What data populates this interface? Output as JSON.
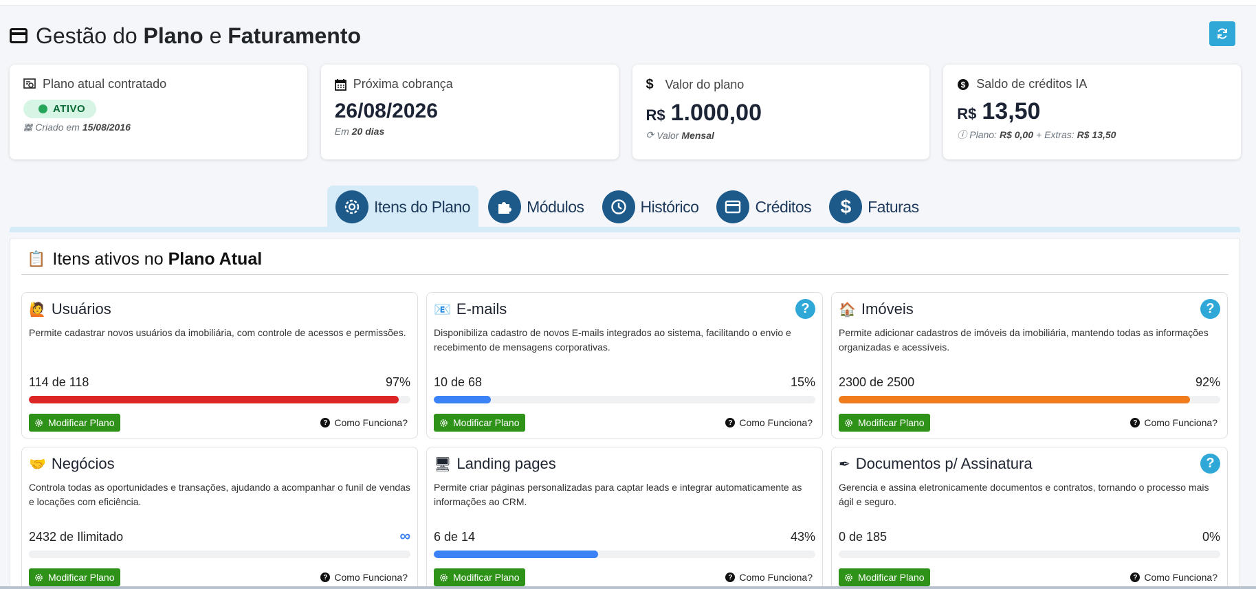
{
  "header": {
    "title_prefix": "Gestão do",
    "title_b1": "Plano",
    "title_mid": "e",
    "title_b2": "Faturamento"
  },
  "stats": {
    "plan": {
      "label": "Plano atual contratado",
      "status": "ATIVO",
      "created_prefix": "Criado em",
      "created_date": "15/08/2016"
    },
    "next": {
      "label": "Próxima cobrança",
      "date": "26/08/2026",
      "in_prefix": "Em",
      "in_days": "20 dias"
    },
    "value": {
      "label": "Valor do plano",
      "currency": "R$",
      "amount": "1.000,00",
      "period_prefix": "Valor",
      "period": "Mensal"
    },
    "credits": {
      "label": "Saldo de créditos IA",
      "currency": "R$",
      "amount": "13,50",
      "plan_prefix": "Plano:",
      "plan_val": "R$ 0,00",
      "extras_prefix": "+ Extras:",
      "extras_val": "R$ 13,50"
    }
  },
  "tabs": [
    {
      "label": "Itens do Plano",
      "icon": "gear-icon"
    },
    {
      "label": "Módulos",
      "icon": "puzzle-icon"
    },
    {
      "label": "Histórico",
      "icon": "history-icon"
    },
    {
      "label": "Créditos",
      "icon": "credit-card-icon"
    },
    {
      "label": "Faturas",
      "icon": "dollar-icon"
    }
  ],
  "panel": {
    "title_prefix": "Itens ativos no",
    "title_bold": "Plano Atual",
    "icon": "📋"
  },
  "cards": [
    {
      "icon": "🙋",
      "title": "Usuários",
      "help": false,
      "desc": "Permite cadastrar novos usuários da imobiliária, com controle de acessos e permissões.",
      "usage": "114 de 118",
      "pct": "97%",
      "fill": 0.97,
      "color": "#dc2626",
      "modify": "Modificar Plano",
      "how": "Como Funciona?"
    },
    {
      "icon": "📧",
      "title": "E-mails",
      "help": true,
      "desc": "Disponibiliza cadastro de novos E-mails integrados ao sistema, facilitando o envio e recebimento de mensagens corporativas.",
      "usage": "10 de 68",
      "pct": "15%",
      "fill": 0.15,
      "color": "#3b82f6",
      "modify": "Modificar Plano",
      "how": "Como Funciona?"
    },
    {
      "icon": "🏠",
      "title": "Imóveis",
      "help": true,
      "desc": "Permite adicionar cadastros de imóveis da imobiliária, mantendo todas as informações organizadas e acessíveis.",
      "usage": "2300 de 2500",
      "pct": "92%",
      "fill": 0.92,
      "color": "#f07c1e",
      "modify": "Modificar Plano",
      "how": "Como Funciona?"
    },
    {
      "icon": "🤝",
      "title": "Negócios",
      "help": false,
      "desc": "Controla todas as oportunidades e transações, ajudando a acompanhar o funil de vendas e locações com eficiência.",
      "usage": "2432 de Ilimitado",
      "pct": "∞",
      "fill": 0,
      "color": "#3b82f6",
      "modify": "Modificar Plano",
      "how": "Como Funciona?"
    },
    {
      "icon": "🖥",
      "title": "Landing pages",
      "help": false,
      "desc": "Permite criar páginas personalizadas para captar leads e integrar automaticamente as informações ao CRM.",
      "usage": "6 de 14",
      "pct": "43%",
      "fill": 0.43,
      "color": "#3b82f6",
      "modify": "Modificar Plano",
      "how": "Como Funciona?"
    },
    {
      "icon": "✒",
      "title": "Documentos p/ Assinatura",
      "help": true,
      "desc": "Gerencia e assina eletronicamente documentos e contratos, tornando o processo mais ágil e seguro.",
      "usage": "0 de 185",
      "pct": "0%",
      "fill": 0,
      "color": "#3b82f6",
      "modify": "Modificar Plano",
      "how": "Como Funciona?"
    }
  ]
}
